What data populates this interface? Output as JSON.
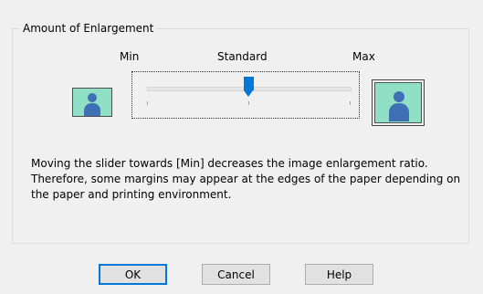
{
  "group": {
    "title": "Amount of Enlargement"
  },
  "slider": {
    "min_label": "Min",
    "standard_label": "Standard",
    "max_label": "Max",
    "value_fraction": 0.5,
    "tick_count": 3
  },
  "images": {
    "small": "small-person-preview-icon",
    "large": "large-person-preview-icon"
  },
  "description": "Moving the slider towards [Min] decreases the image enlargement ratio. Therefore, some margins may appear at the edges of the paper depending on the paper and printing environment.",
  "buttons": {
    "ok": "OK",
    "cancel": "Cancel",
    "help": "Help"
  },
  "colors": {
    "accent": "#0078d7",
    "preview_bg": "#8fe0c4",
    "person": "#3f6fb5"
  }
}
